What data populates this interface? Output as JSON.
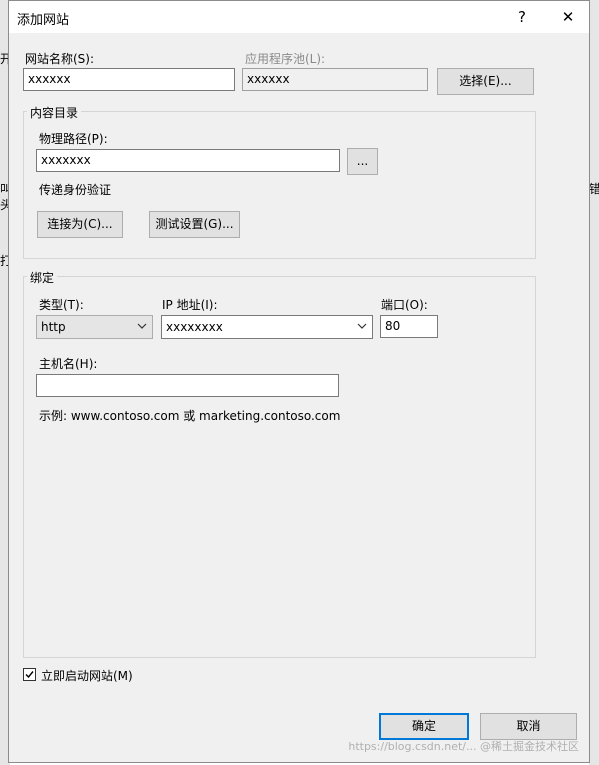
{
  "window": {
    "title": "添加网站",
    "help_glyph": "?",
    "close_glyph": "✕"
  },
  "background": {
    "fragments": [
      "开",
      "叫",
      "头",
      "打",
      "错"
    ]
  },
  "site_name": {
    "label": "网站名称(S):",
    "value": "xxxxxx"
  },
  "app_pool": {
    "label": "应用程序池(L):",
    "value": "xxxxxx",
    "select_label": "选择(E)..."
  },
  "content_directory": {
    "group_title": "内容目录",
    "physical_path": {
      "label": "物理路径(P):",
      "value": "xxxxxxx",
      "browse_label": "..."
    },
    "passthrough_auth_label": "传递身份验证",
    "connect_as_label": "连接为(C)...",
    "test_settings_label": "测试设置(G)..."
  },
  "binding": {
    "group_title": "绑定",
    "type": {
      "label": "类型(T):",
      "value": "http"
    },
    "ip_address": {
      "label": "IP 地址(I):",
      "value": "xxxxxxxx"
    },
    "port": {
      "label": "端口(O):",
      "value": "80"
    },
    "host_name": {
      "label": "主机名(H):",
      "value": ""
    },
    "example": "示例: www.contoso.com 或 marketing.contoso.com"
  },
  "start_immediately": {
    "label": "立即启动网站(M)",
    "checked": true
  },
  "footer": {
    "ok_label": "确定",
    "cancel_label": "取消"
  },
  "watermark": "https://blog.csdn.net/... @稀土掘金技术社区"
}
